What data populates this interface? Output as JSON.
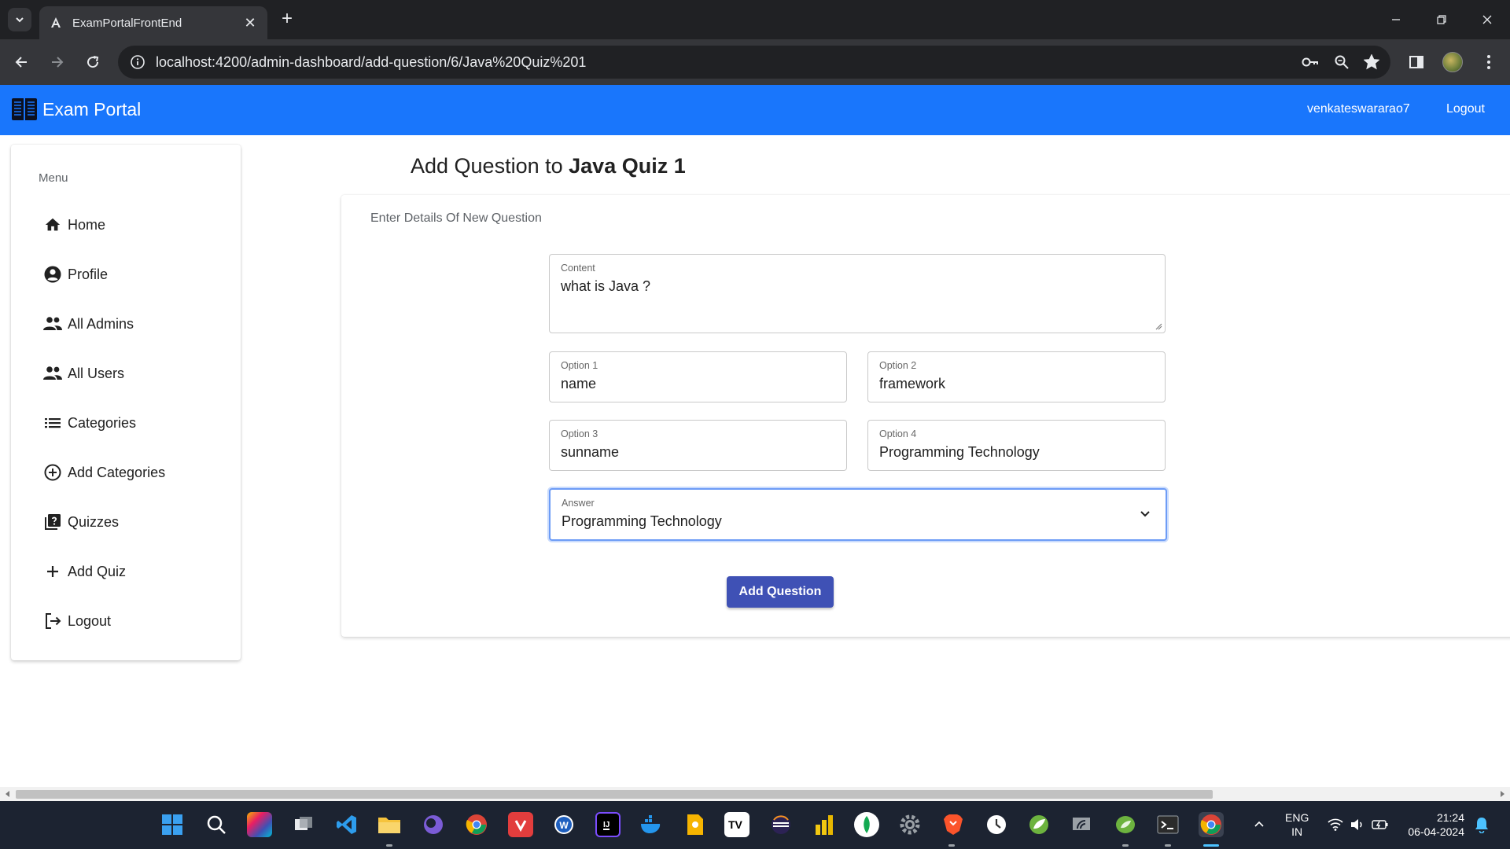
{
  "browser": {
    "tab_title": "ExamPortalFrontEnd",
    "url": "localhost:4200/admin-dashboard/add-question/6/Java%20Quiz%201"
  },
  "app": {
    "brand": "Exam Portal",
    "username": "venkateswararao7",
    "logout_label": "Logout",
    "accent_color": "#1976fc"
  },
  "sidebar": {
    "menu_label": "Menu",
    "items": [
      {
        "label": "Home",
        "icon": "home-icon"
      },
      {
        "label": "Profile",
        "icon": "account-circle-icon"
      },
      {
        "label": "All Admins",
        "icon": "people-icon"
      },
      {
        "label": "All Users",
        "icon": "people-icon"
      },
      {
        "label": "Categories",
        "icon": "list-icon"
      },
      {
        "label": "Add Categories",
        "icon": "add-circle-icon"
      },
      {
        "label": "Quizzes",
        "icon": "quiz-icon"
      },
      {
        "label": "Add Quiz",
        "icon": "plus-icon"
      },
      {
        "label": "Logout",
        "icon": "logout-icon"
      }
    ]
  },
  "main": {
    "title_prefix": "Add Question to ",
    "quiz_title": "Java Quiz 1",
    "card_subtitle": "Enter Details Of New Question",
    "content": {
      "label": "Content",
      "value": "what  is Java ?"
    },
    "options": [
      {
        "label": "Option 1",
        "value": "name"
      },
      {
        "label": "Option 2",
        "value": "framework"
      },
      {
        "label": "Option 3",
        "value": "sunname"
      },
      {
        "label": "Option 4",
        "value": "Programming Technology"
      }
    ],
    "answer": {
      "label": "Answer",
      "value": "Programming Technology"
    },
    "submit_label": "Add Question",
    "button_color": "#3f51b5"
  },
  "taskbar": {
    "lang_line1": "ENG",
    "lang_line2": "IN",
    "time": "21:24",
    "date": "06-04-2024"
  }
}
